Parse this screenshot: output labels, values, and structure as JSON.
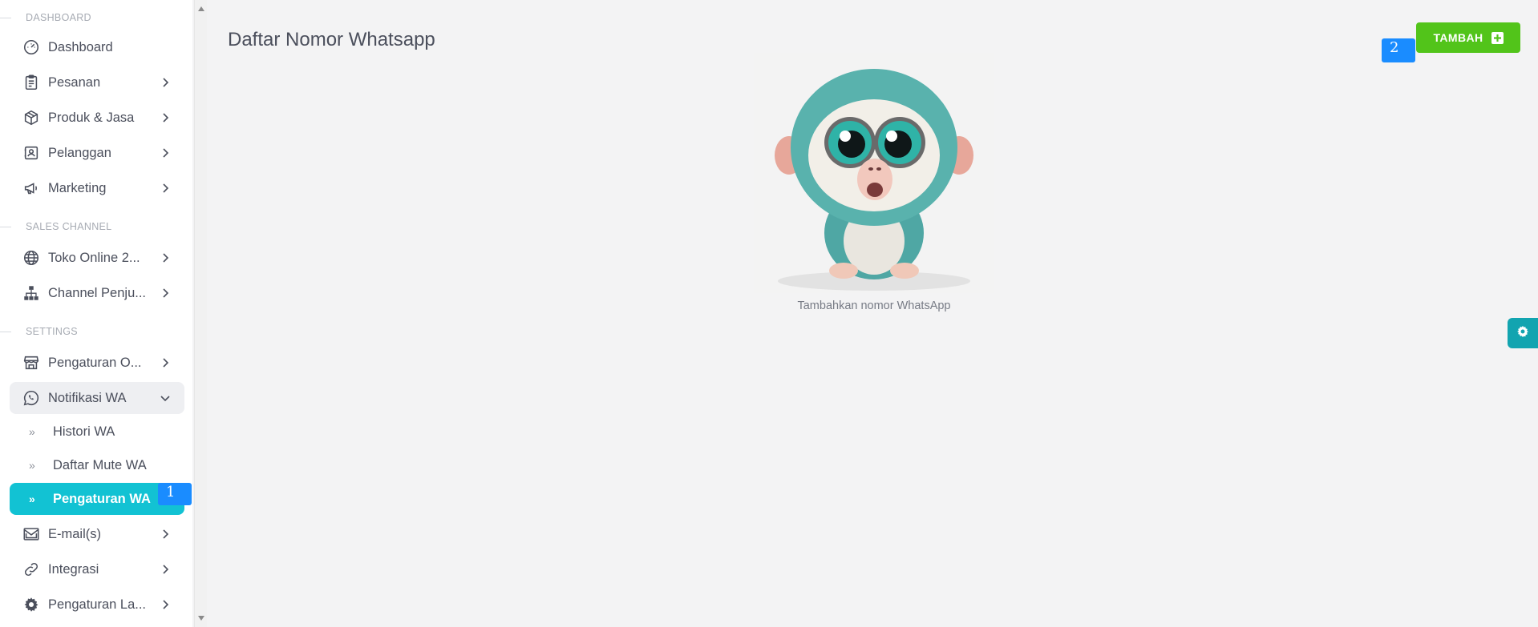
{
  "sidebar": {
    "sections": {
      "dashboard": "DASHBOARD",
      "sales": "SALES CHANNEL",
      "settings": "SETTINGS"
    },
    "items": {
      "dashboard": "Dashboard",
      "pesanan": "Pesanan",
      "produk": "Produk & Jasa",
      "pelanggan": "Pelanggan",
      "marketing": "Marketing",
      "toko": "Toko Online 2...",
      "channel": "Channel Penju...",
      "pengaturan_o": "Pengaturan O...",
      "notifikasi": "Notifikasi WA",
      "email": "E-mail(s)",
      "integrasi": "Integrasi",
      "pengaturan_la": "Pengaturan La..."
    },
    "subitems": {
      "histori": "Histori WA",
      "mute": "Daftar Mute WA",
      "pengaturan_wa": "Pengaturan WA"
    }
  },
  "main": {
    "title": "Daftar Nomor Whatsapp",
    "empty_text": "Tambahkan nomor WhatsApp",
    "add_button": "TAMBAH"
  },
  "markers": {
    "m1": "1",
    "m2": "2"
  },
  "colors": {
    "accent": "#12c2d3",
    "add_button": "#52c41a",
    "marker": "#1a8cff",
    "settings_fab": "#12a4b0"
  },
  "icons": {
    "dashboard": "gauge-icon",
    "pesanan": "clipboard-icon",
    "produk": "box-icon",
    "pelanggan": "contact-card-icon",
    "marketing": "megaphone-icon",
    "toko": "globe-icon",
    "channel": "sitemap-icon",
    "pengaturan_o": "store-icon",
    "notifikasi": "whatsapp-icon",
    "email": "mail-icon",
    "integrasi": "link-icon",
    "pengaturan_la": "gear-icon"
  }
}
